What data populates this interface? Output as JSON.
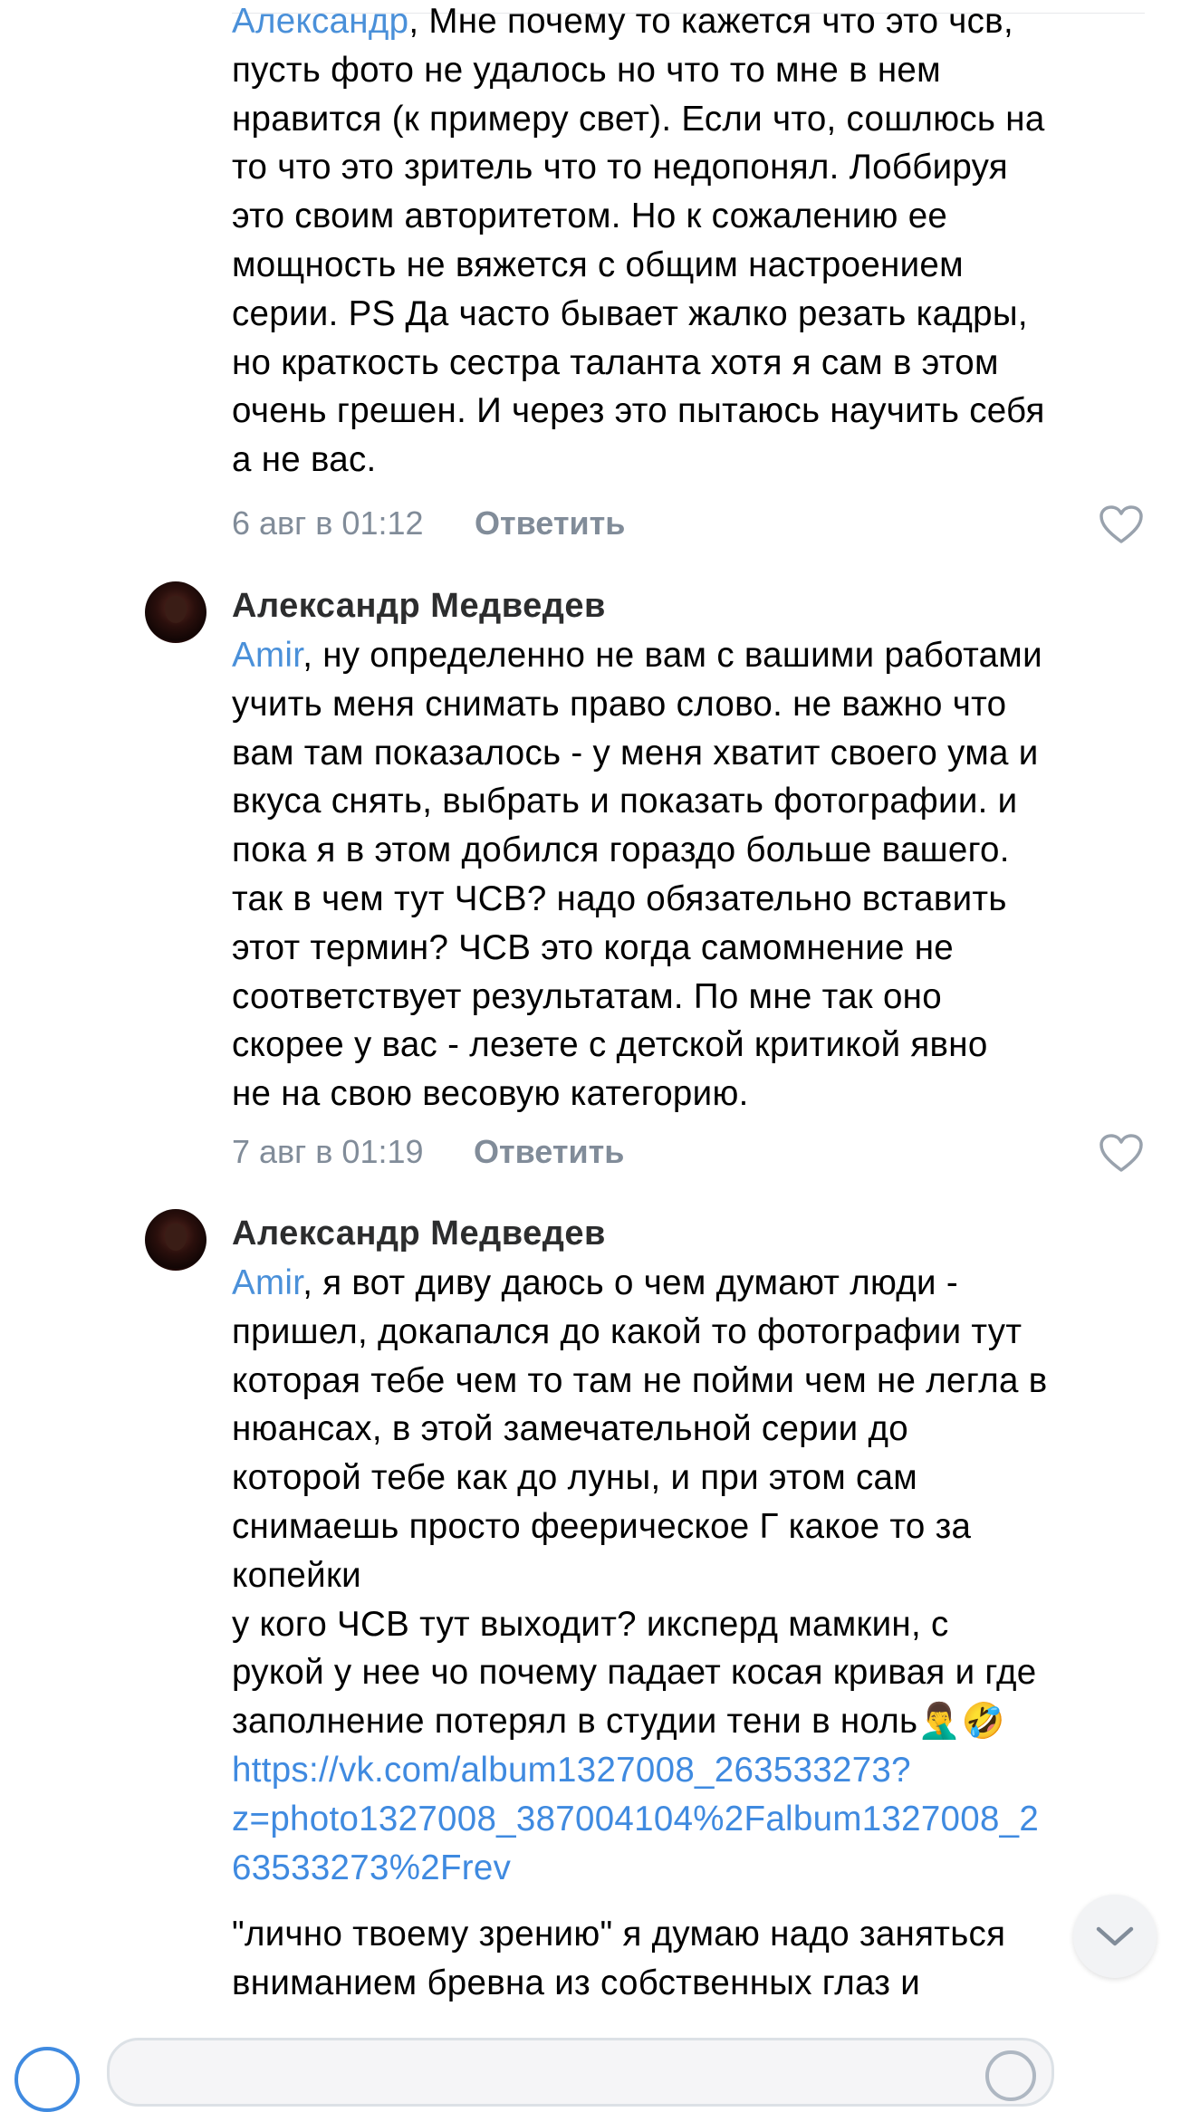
{
  "comments": [
    {
      "author": "",
      "mention": "Александр",
      "lines": [
        ", Мне почему то кажется что это чсв,",
        "пусть фото не удалось но что то мне в нем",
        "нравится (к примеру свет). Если что, сошлюсь на",
        "то что это зритель что то недопонял. Лоббируя",
        "это своим авторитетом. Но к сожалению ее",
        "мощность не вяжется с общим настроением",
        "серии. PS Да часто бывает жалко резать кадры,",
        "но краткость сестра таланта хотя я сам в этом",
        "очень грешен. И через это пытаюсь научить себя",
        "а не вас."
      ],
      "date": "6 авг в 01:12",
      "reply": "Ответить"
    },
    {
      "author": "Александр Медведев",
      "mention": "Amir",
      "lines": [
        ", ну определенно не вам с вашими работами",
        "учить меня снимать право слово. не важно что",
        "вам там показалось - у меня хватит своего ума и",
        "вкуса снять, выбрать и показать фотографии. и",
        "пока я в этом добился гораздо больше вашего.",
        "так в чем тут ЧСВ? надо обязательно вставить",
        "этот термин? ЧСВ это когда самомнение не",
        "соответствует результатам. По мне так оно",
        "скорее у вас - лезете с детской критикой явно",
        "не на свою весовую категорию."
      ],
      "date": "7 авг в 01:19",
      "reply": "Ответить"
    },
    {
      "author": "Александр Медведев",
      "mention": "Amir",
      "lines": [
        ", я вот диву даюсь о чем думают люди -",
        "пришел, докапался до какой то фотографии тут",
        "которая тебе чем то там не пойми чем не легла в",
        "нюансах, в этой замечательной серии до",
        "которой тебе как до луны, и при этом сам",
        "снимаешь просто феерическое Г какое то за",
        "копейки",
        "у кого ЧСВ тут выходит? иксперд мамкин, с",
        "рукой у нее чо почему падает косая кривая и где",
        "заполнение потерял в студии тени в ноль🤦‍♂️🤣"
      ],
      "link_lines": [
        "https://vk.com/album1327008_263533273?",
        "z=photo1327008_387004104%2Falbum1327008_2",
        "63533273%2Frev"
      ],
      "after_lines": [
        "\"лично твоему зрению\" я думаю надо заняться",
        "вниманием бревна из собственных глаз и"
      ]
    }
  ],
  "icons": {
    "like": "heart-outline-icon",
    "scroll_down": "chevron-down-icon"
  },
  "colors": {
    "link": "#3f8ae0",
    "meta": "#818c99",
    "author": "#2c2d2e"
  }
}
